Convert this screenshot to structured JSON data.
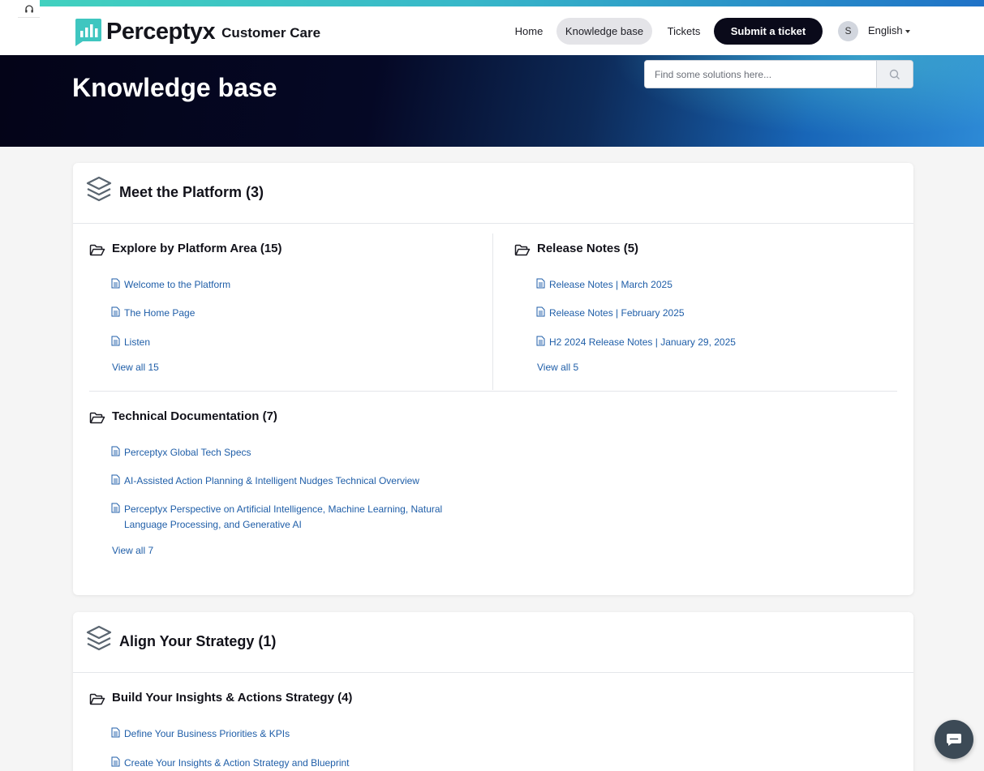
{
  "brand": {
    "name": "Perceptyx",
    "sub": "Customer Care"
  },
  "nav": {
    "home": "Home",
    "knowledge_base": "Knowledge base",
    "tickets": "Tickets",
    "submit": "Submit a ticket",
    "avatar_initial": "S",
    "language": "English"
  },
  "hero": {
    "title": "Knowledge base",
    "search_placeholder": "Find some solutions here..."
  },
  "sections": [
    {
      "title": "Meet the Platform (3)",
      "folders": [
        {
          "title": "Explore by Platform Area (15)",
          "articles": [
            "Welcome to the Platform",
            "The Home Page",
            "Listen"
          ],
          "view_all": "View all 15"
        },
        {
          "title": "Release Notes (5)",
          "articles": [
            "Release Notes | March 2025",
            "Release Notes | February 2025",
            "H2 2024 Release Notes | January 29, 2025"
          ],
          "view_all": "View all 5"
        },
        {
          "title": "Technical Documentation (7)",
          "articles": [
            "Perceptyx Global Tech Specs",
            "AI-Assisted Action Planning & Intelligent Nudges Technical Overview",
            "Perceptyx Perspective on Artificial Intelligence, Machine Learning, Natural Language Processing, and Generative AI"
          ],
          "view_all": "View all 7"
        }
      ]
    },
    {
      "title": "Align Your Strategy (1)",
      "folders": [
        {
          "title": "Build Your Insights & Actions Strategy (4)",
          "articles": [
            "Define Your Business Priorities & KPIs",
            "Create Your Insights & Action Strategy and Blueprint"
          ]
        }
      ]
    }
  ],
  "colors": {
    "accent_teal": "#41d1bf",
    "link_blue": "#1f5ea8",
    "submit_bg": "#0a0a1a"
  }
}
